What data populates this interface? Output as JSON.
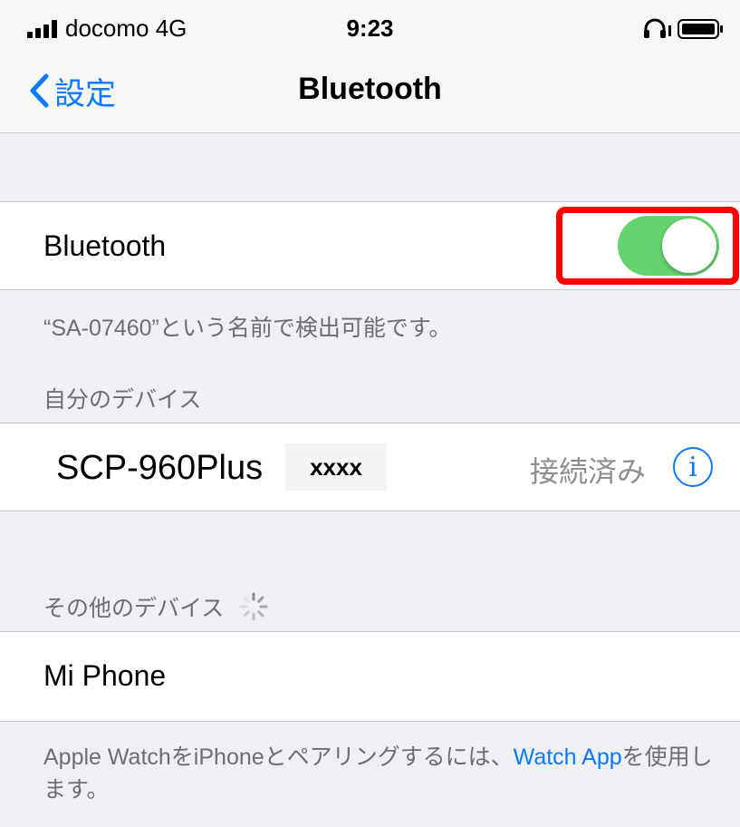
{
  "status_bar": {
    "carrier": "docomo  4G",
    "time": "9:23"
  },
  "nav": {
    "back_label": "設定",
    "title": "Bluetooth"
  },
  "bluetooth": {
    "label": "Bluetooth",
    "enabled": true,
    "discoverable_text": "“SA-07460”という名前で検出可能です。"
  },
  "my_devices": {
    "header": "自分のデバイス",
    "items": [
      {
        "name": "SCP-960Plus",
        "masked_suffix": "xxxx",
        "status": "接続済み"
      }
    ]
  },
  "other_devices": {
    "header": "その他のデバイス",
    "items": [
      {
        "name": "Mi Phone"
      }
    ]
  },
  "footer": {
    "text_before": "Apple WatchをiPhoneとペアリングするには、",
    "link": "Watch App",
    "text_after": "を使用します。"
  },
  "colors": {
    "accent": "#0a7aff",
    "toggle_on": "#65d46e",
    "highlight": "#ff0000"
  }
}
